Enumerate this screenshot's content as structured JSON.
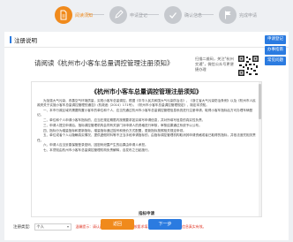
{
  "steps": [
    {
      "label": "阅读须知",
      "state": "active",
      "icon": "document-icon"
    },
    {
      "label": "申请登记",
      "state": "idle",
      "icon": "edit-icon"
    },
    {
      "label": "确认信息",
      "state": "idle",
      "icon": "check-icon"
    },
    {
      "label": "完成申请",
      "state": "idle",
      "icon": "flag-icon"
    }
  ],
  "panel": {
    "title": "注册说明",
    "read_title": "请阅读《杭州市小客车总量调控管理注册须知》",
    "qr_text": "扫描二维码，关注\"杭州交通\"，微信公众号更便捷办理"
  },
  "side_buttons": [
    "申请登记",
    "办事指南",
    "常见问题"
  ],
  "doc": {
    "title": "《杭州市小客车总量调控管理注册须知》",
    "paragraphs": [
      "为加强大气污染、改善空气环境质量，实现小客车总量调控，根据《中华人民共和国大气污染防治法》、《浙江省大气污染防治条例》以及《杭州市人民政府关于实施小客车总量调控管理的通告》(杭政函〔2014〕171号)，《杭州市小客车总量调控管理规定》，制定本须知。",
      "一、本市行政区域内需要购置小客车的单位和个人，应当先通过杭州市小客车总量调控管理信息系统进行注册申请，取得小客车指标后方可办理车辆登记。",
      "二、单位和个人申请小客车指标的，应当在规定期限内按照要求如实填写申请信息，并对所填写信息的真实性负责。",
      "三、申请人提交申请后，指标调控管理机构会同有关部门对申请人的资格进行审核，审核结果通过系统予以公布。",
      "四、指标分为增量指标和更新指标。增量指标通过摇号和竞价方式配置，更新指标按照相关规定申领。",
      "五、单位或者个人以隐瞒真实情况、提供虚假材料等不正当手段申请指标的，由指标调控管理机构取消其申请资格或者已取得的指标，并依法追究相关责任。",
      "六、申请人应当妥善保管登录密码，因密码泄露产生的后果由申请人承担。",
      "七、本须知由杭州市小客车总量调控管理机构负责解释，自发布之日起施行。"
    ],
    "footer": "指标申请"
  },
  "cert": {
    "label": "注册类型:",
    "selected": "个人",
    "warning": "温馨提示：请认真阅读以上须知内容并按要求填写申请信息，确保申请信息真实有效。"
  },
  "buttons": {
    "back": "返回",
    "next": "下一步"
  },
  "colors": {
    "accent": "#f08a1c",
    "primary": "#2b7be0",
    "warning": "#e03a2a"
  }
}
